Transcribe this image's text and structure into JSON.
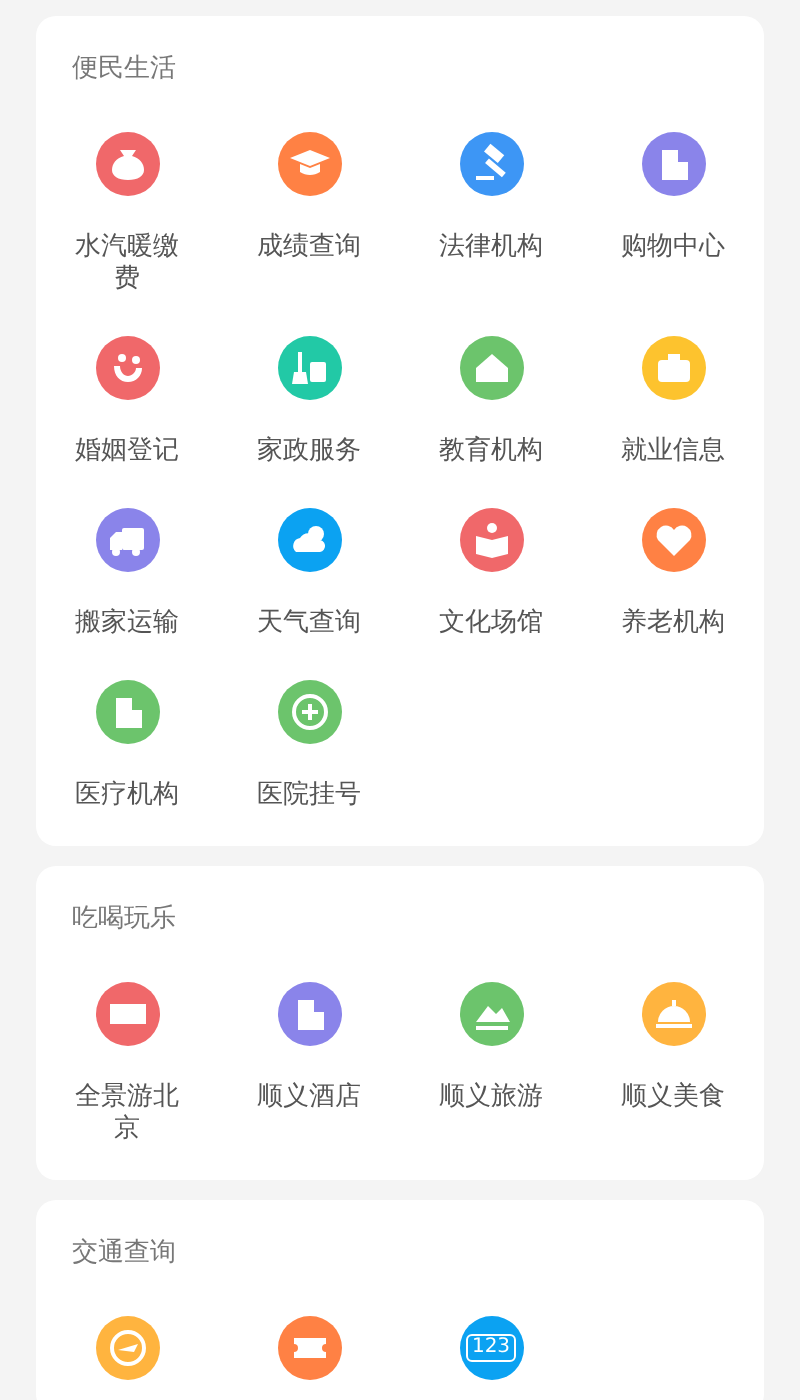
{
  "sections": [
    {
      "title": "便民生活",
      "items": [
        {
          "label": "水汽暖缴费",
          "color": "#f0686a"
        },
        {
          "label": "成绩查询",
          "color": "#ff8144"
        },
        {
          "label": "法律机构",
          "color": "#3d96f5"
        },
        {
          "label": "购物中心",
          "color": "#8a84ea"
        },
        {
          "label": "婚姻登记",
          "color": "#f0686a"
        },
        {
          "label": "家政服务",
          "color": "#22c9a6"
        },
        {
          "label": "教育机构",
          "color": "#6cc46c"
        },
        {
          "label": "就业信息",
          "color": "#fdc32e"
        },
        {
          "label": "搬家运输",
          "color": "#8a84ea"
        },
        {
          "label": "天气查询",
          "color": "#0ba2f2"
        },
        {
          "label": "文化场馆",
          "color": "#f0686a"
        },
        {
          "label": "养老机构",
          "color": "#ff8144"
        },
        {
          "label": "医疗机构",
          "color": "#6cc46c"
        },
        {
          "label": "医院挂号",
          "color": "#6cc46c"
        }
      ]
    },
    {
      "title": "吃喝玩乐",
      "items": [
        {
          "label": "全景游北京",
          "color": "#f0686a"
        },
        {
          "label": "顺义酒店",
          "color": "#8a84ea"
        },
        {
          "label": "顺义旅游",
          "color": "#6cc46c"
        },
        {
          "label": "顺义美食",
          "color": "#ffb43f"
        }
      ]
    },
    {
      "title": "交通查询",
      "items": [
        {
          "color": "#ffb43f"
        },
        {
          "color": "#ff8144"
        },
        {
          "color": "#0ba2f2",
          "glyph": "123"
        }
      ]
    }
  ]
}
